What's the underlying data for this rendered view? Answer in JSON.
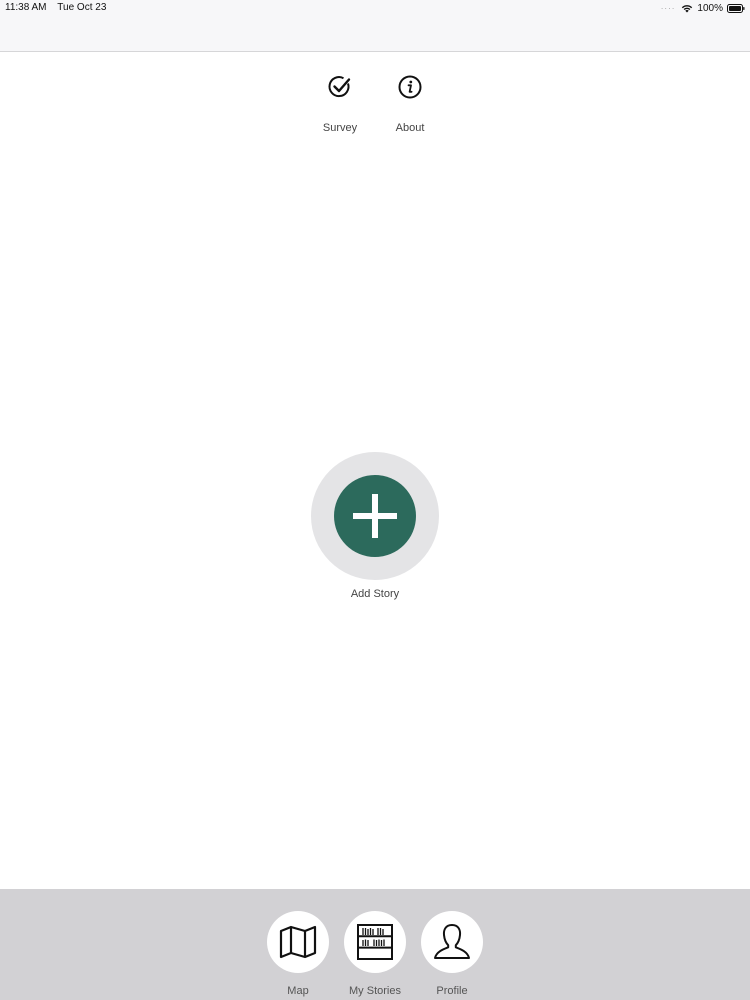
{
  "status_bar": {
    "time": "11:38 AM",
    "date": "Tue Oct 23",
    "battery": "100%",
    "icons": [
      "wifi-icon",
      "battery-icon"
    ]
  },
  "top_actions": [
    {
      "label": "Survey",
      "icon": "check-circle-icon"
    },
    {
      "label": "About",
      "icon": "info-circle-icon"
    }
  ],
  "main": {
    "add_story_label": "Add Story",
    "accent_color": "#2c6a5c"
  },
  "tabbar": {
    "items": [
      {
        "label": "Map",
        "icon": "map-icon"
      },
      {
        "label": "My Stories",
        "icon": "bookshelf-icon"
      },
      {
        "label": "Profile",
        "icon": "person-icon"
      }
    ],
    "background": "#d2d1d4"
  }
}
